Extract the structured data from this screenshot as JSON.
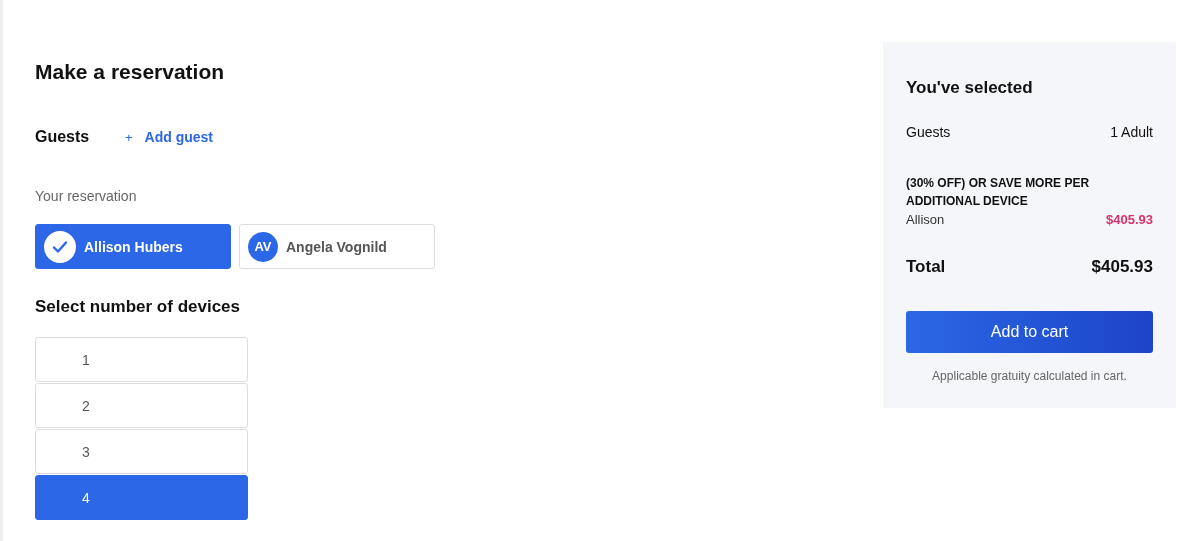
{
  "title": "Make a reservation",
  "guests": {
    "label": "Guests",
    "add_label": "+",
    "add_link": "Add guest"
  },
  "reservation": {
    "label": "Your reservation",
    "people": [
      {
        "name": "Allison Hubers",
        "selected": true
      },
      {
        "name": "Angela Vognild",
        "initials": "AV",
        "selected": false
      }
    ]
  },
  "devices": {
    "title": "Select number of devices",
    "options": [
      {
        "label": "1",
        "selected": false
      },
      {
        "label": "2",
        "selected": false
      },
      {
        "label": "3",
        "selected": false
      },
      {
        "label": "4",
        "selected": true
      }
    ]
  },
  "summary": {
    "title": "You've selected",
    "guests_label": "Guests",
    "guests_value": "1 Adult",
    "offer": "(30% OFF) OR SAVE MORE PER ADDITIONAL DEVICE",
    "offer_name": "Allison",
    "offer_price": "$405.93",
    "total_label": "Total",
    "total_value": "$405.93",
    "button": "Add to cart",
    "note": "Applicable gratuity calculated in cart."
  }
}
